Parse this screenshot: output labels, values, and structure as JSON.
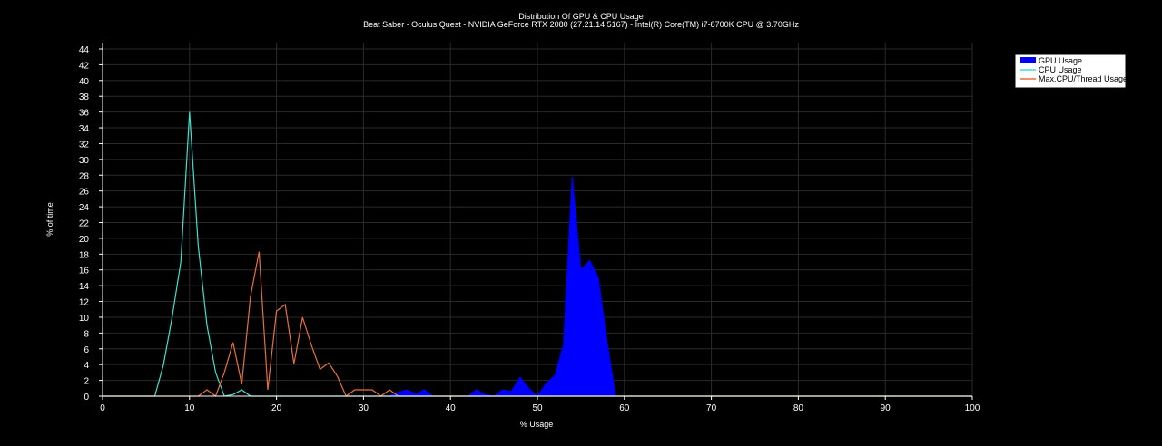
{
  "chart_data": {
    "type": "area",
    "title": "Distribution Of GPU & CPU Usage",
    "subtitle": "Beat Saber - Oculus Quest - NVIDIA GeForce RTX 2080 (27.21.14.5167) - Intel(R) Core(TM) i7-8700K CPU @ 3.70GHz",
    "xlabel": "% Usage",
    "ylabel": "% of time",
    "xlim": [
      0,
      100
    ],
    "ylim": [
      0,
      45
    ],
    "xticks": [
      0,
      10,
      20,
      30,
      40,
      50,
      60,
      70,
      80,
      90,
      100
    ],
    "yticks": [
      0,
      2,
      4,
      6,
      8,
      10,
      12,
      14,
      16,
      18,
      20,
      22,
      24,
      26,
      28,
      30,
      32,
      34,
      36,
      38,
      40,
      42,
      44
    ],
    "grid": true,
    "legend_position": "top-right",
    "series": [
      {
        "name": "GPU Usage",
        "type": "area",
        "color": "#0000ff",
        "x": [
          0,
          33,
          34,
          35,
          36,
          37,
          38,
          42,
          43,
          44,
          45,
          46,
          47,
          48,
          49,
          50,
          51,
          52,
          53,
          54,
          55,
          56,
          57,
          58,
          59,
          60,
          100
        ],
        "y": [
          0,
          0,
          0.5,
          0.8,
          0.3,
          0.8,
          0,
          0,
          0.8,
          0.2,
          0,
          0.8,
          0.6,
          2.4,
          1.0,
          0,
          1.6,
          2.6,
          6.5,
          27.8,
          16.0,
          17.2,
          15.0,
          7.0,
          0,
          0,
          0
        ]
      },
      {
        "name": "CPU Usage",
        "type": "line",
        "color": "#40e0d0",
        "x": [
          0,
          6,
          7,
          8,
          9,
          10,
          11,
          12,
          13,
          14,
          15,
          16,
          17,
          18,
          100
        ],
        "y": [
          0,
          0,
          4.0,
          10.0,
          17.0,
          36.0,
          19.0,
          9.0,
          3.0,
          0,
          0.2,
          0.8,
          0,
          0,
          0
        ]
      },
      {
        "name": "Max.CPU/Thread Usage",
        "type": "line",
        "color": "#e8703a",
        "x": [
          0,
          11,
          12,
          13,
          14,
          15,
          16,
          17,
          18,
          19,
          20,
          21,
          22,
          23,
          24,
          25,
          26,
          27,
          28,
          29,
          30,
          31,
          32,
          33,
          34,
          35,
          100
        ],
        "y": [
          0,
          0,
          0.8,
          0,
          3.0,
          6.8,
          1.5,
          12.6,
          18.3,
          0.8,
          10.8,
          11.6,
          4.1,
          10.0,
          6.5,
          3.4,
          4.2,
          2.5,
          0,
          0.8,
          0.8,
          0.8,
          0,
          0.8,
          0,
          0,
          0
        ]
      }
    ]
  }
}
